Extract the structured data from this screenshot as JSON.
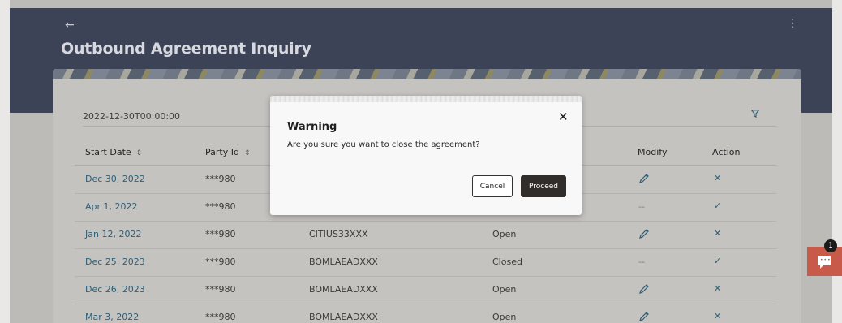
{
  "header": {
    "title": "Outbound Agreement Inquiry",
    "back_icon": "←",
    "kebab_icon": "⋮"
  },
  "filter": {
    "date": "2022-12-30T00:00:00"
  },
  "table": {
    "columns": {
      "start_date": "Start Date",
      "party_id": "Party Id",
      "modify": "Modify",
      "action": "Action"
    },
    "rows": [
      {
        "start_date": "Dec 30, 2022",
        "party_id": "***980",
        "bic": "",
        "status": "",
        "modify": "edit",
        "action": "✕"
      },
      {
        "start_date": "Apr 1, 2022",
        "party_id": "***980",
        "bic": "",
        "status": "",
        "modify": "--",
        "action": "✓"
      },
      {
        "start_date": "Jan 12, 2022",
        "party_id": "***980",
        "bic": "CITIUS33XXX",
        "status": "Open",
        "modify": "edit",
        "action": "✕"
      },
      {
        "start_date": "Dec 25, 2023",
        "party_id": "***980",
        "bic": "BOMLAEADXXX",
        "status": "Closed",
        "modify": "--",
        "action": "✓"
      },
      {
        "start_date": "Dec 26, 2023",
        "party_id": "***980",
        "bic": "BOMLAEADXXX",
        "status": "Open",
        "modify": "edit",
        "action": "✕"
      },
      {
        "start_date": "Mar 3, 2022",
        "party_id": "***980",
        "bic": "BOMLAEADXXX",
        "status": "Open",
        "modify": "edit",
        "action": "✕"
      }
    ]
  },
  "modal": {
    "title": "Warning",
    "message": "Are you sure you want to close the agreement?",
    "close_icon": "✕",
    "cancel_label": "Cancel",
    "proceed_label": "Proceed"
  },
  "chat": {
    "badge_count": "1"
  },
  "colors": {
    "header_bg": "#3d4357",
    "link": "#2d5f77",
    "proceed_bg": "#312d2a",
    "chat_bg": "#c75a48"
  }
}
